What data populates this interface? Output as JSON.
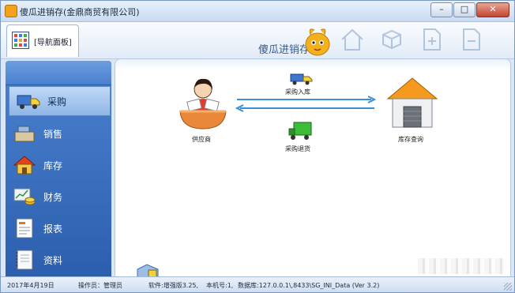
{
  "window": {
    "title": "傻瓜进销存(金鼎商贸有限公司)",
    "controls": [
      "minimize-button",
      "maximize-button",
      "close-button"
    ]
  },
  "toolbar": {
    "nav_tab_label": "[导航面板]",
    "brand_text": "傻瓜进销存",
    "icons": [
      "home-icon",
      "cube-icon",
      "add-doc-icon",
      "remove-doc-icon"
    ]
  },
  "sidebar": {
    "items": [
      {
        "label": "采购",
        "icon": "truck-icon",
        "active": true
      },
      {
        "label": "销售",
        "icon": "cash-register-icon",
        "active": false
      },
      {
        "label": "库存",
        "icon": "house-icon",
        "active": false
      },
      {
        "label": "财务",
        "icon": "chart-coins-icon",
        "active": false
      },
      {
        "label": "报表",
        "icon": "report-icon",
        "active": false
      },
      {
        "label": "资料",
        "icon": "notebook-icon",
        "active": false
      }
    ]
  },
  "diagram": {
    "supplier_label": "供应商",
    "purchase_in_label": "采购入库",
    "warehouse_label": "库存查询",
    "purchase_return_label": "采购退货"
  },
  "status": {
    "date": "2017年4月19日",
    "operator": "操作员：管理员",
    "software": "软件:增强版3.25,",
    "machine": "本机号:1,",
    "database": "数据库:127.0.0.1\\,8433\\SG_INI_Data (Ver 3.2)"
  },
  "colors": {
    "sidebar_blue": "#3a6fbf",
    "arrow_blue": "#3a8fd6",
    "title_blue": "#dbe7f6"
  }
}
